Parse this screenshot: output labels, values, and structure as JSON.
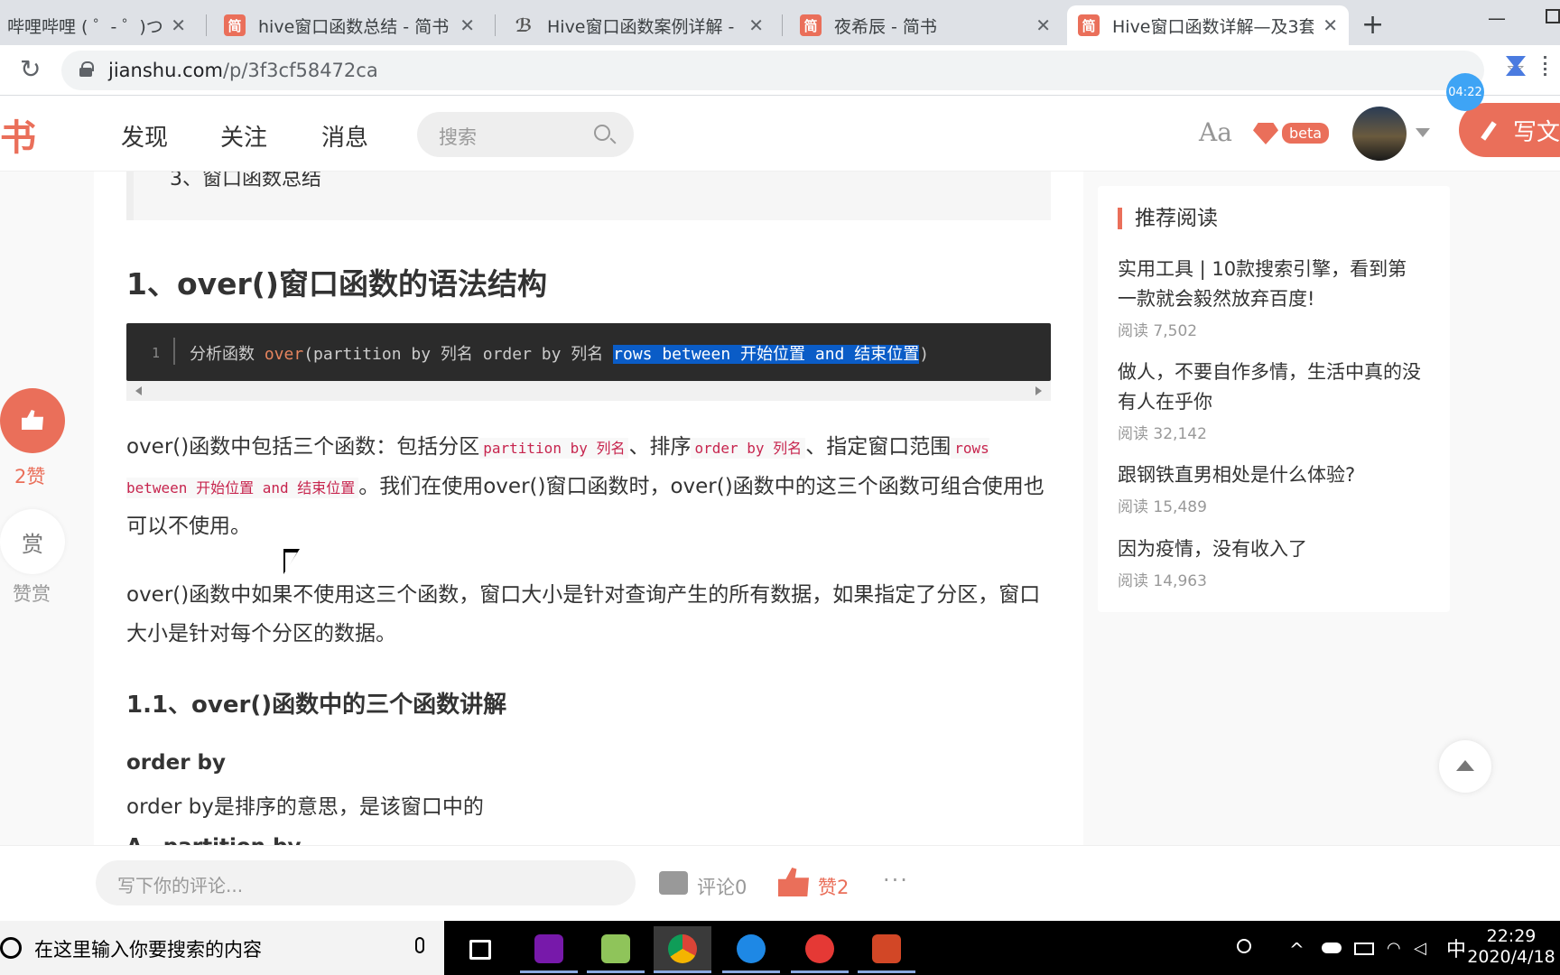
{
  "browser": {
    "tabs": [
      {
        "title": "哔哩哔哩 ( ゜- ゜)つロ 干杯~-",
        "icon": "bilibili-icon",
        "active": false
      },
      {
        "title": "hive窗口函数总结 - 简书",
        "icon": "简",
        "active": false
      },
      {
        "title": "Hive窗口函数案例详解 - su",
        "icon": "csdn-icon",
        "active": false
      },
      {
        "title": "夜希辰 - 简书",
        "icon": "简",
        "active": false
      },
      {
        "title": "Hive窗口函数详解—及3套",
        "icon": "简",
        "active": true
      }
    ],
    "new_tab": "+",
    "url_host": "jianshu.com",
    "url_path": "/p/3f3cf58472ca",
    "timer": "04:22"
  },
  "site": {
    "logo": "书",
    "nav": [
      "发现",
      "关注",
      "消息"
    ],
    "search_placeholder": "搜索",
    "font_toggle": "Aa",
    "beta": "beta",
    "write": "写文"
  },
  "article": {
    "toc_item": "3、窗口函数总结",
    "h1": "1、over()窗口函数的语法结构",
    "code": {
      "line_no": "1",
      "prefix": "分析函数 ",
      "kw": "over",
      "mid": "(partition by 列名 order by 列名 ",
      "selected": "rows between 开始位置 and 结束位置",
      "suffix": ")"
    },
    "p1": {
      "t1": "over()函数中包括三个函数：包括分区",
      "c1": "partition by 列名",
      "t2": "、排序",
      "c2": "order by 列名",
      "t3": "、指定窗口范围",
      "c3": "rows between 开始位置 and 结束位置",
      "t4": "。我们在使用over()窗口函数时，over()函数中的这三个函数可组合使用也可以不使用。"
    },
    "p2": "over()函数中如果不使用这三个函数，窗口大小是针对查询产生的所有数据，如果指定了分区，窗口大小是针对每个分区的数据。",
    "h2": "1.1、over()函数中的三个函数讲解",
    "h3": "order by",
    "p3": "order by是排序的意思，是该窗口中的",
    "p4": "A、partition by"
  },
  "side": {
    "like_count": "2赞",
    "reward_icon": "赏",
    "reward_label": "赞赏"
  },
  "recommend": {
    "title": "推荐阅读",
    "items": [
      {
        "title": "实用工具 | 10款搜索引擎，看到第一款就会毅然放弃百度!",
        "reads": "阅读 7,502"
      },
      {
        "title": "做人，不要自作多情，生活中真的没有人在乎你",
        "reads": "阅读 32,142"
      },
      {
        "title": "跟钢铁直男相处是什么体验?",
        "reads": "阅读 15,489"
      },
      {
        "title": "因为疫情，没有收入了",
        "reads": "阅读 14,963"
      }
    ]
  },
  "comment_bar": {
    "placeholder": "写下你的评论...",
    "comments": "评论0",
    "likes": "赞2",
    "more": "···"
  },
  "taskbar": {
    "search_placeholder": "在这里输入你要搜索的内容",
    "ime": "中",
    "time": "22:29",
    "date": "2020/4/18",
    "apps": [
      "task-view",
      "onenote",
      "notepad",
      "chrome",
      "feishu",
      "mindnode",
      "powerpoint"
    ]
  },
  "colors": {
    "brand": "#ea6f5a",
    "code_bg": "#2b2b2b",
    "selection": "#0a5cc7"
  }
}
